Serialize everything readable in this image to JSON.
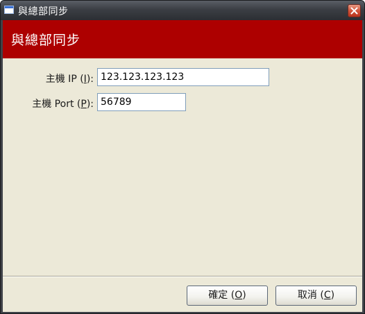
{
  "window": {
    "title": "與總部同步"
  },
  "header": {
    "title": "與總部同步",
    "background_color": "#ad0000"
  },
  "form": {
    "host_ip": {
      "label_prefix": "主機 IP (",
      "label_mnemonic": "I",
      "label_suffix": "):",
      "value": "123.123.123.123"
    },
    "host_port": {
      "label_prefix": "主機 Port (",
      "label_mnemonic": "P",
      "label_suffix": "):",
      "value": "56789"
    }
  },
  "buttons": {
    "ok": {
      "prefix": "確定 (",
      "mnemonic": "O",
      "suffix": ")"
    },
    "cancel": {
      "prefix": "取消 (",
      "mnemonic": "C",
      "suffix": ")"
    }
  },
  "icons": {
    "app": "window-icon",
    "close": "close-icon"
  }
}
